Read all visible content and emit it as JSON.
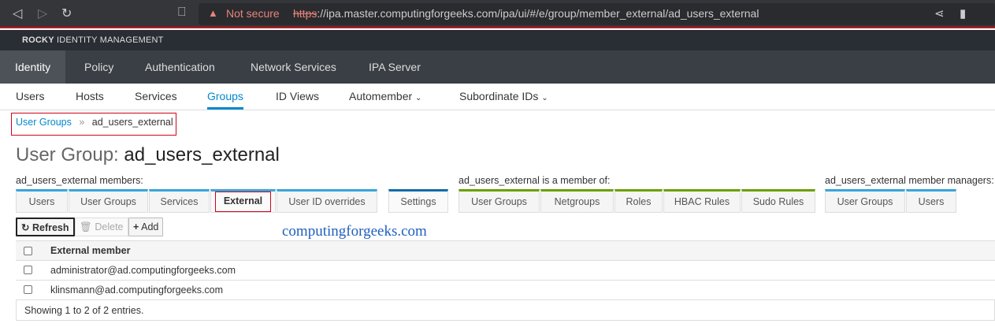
{
  "browser": {
    "security_label": "Not secure",
    "url_scheme": "https",
    "url_rest": "://ipa.master.computingforgeeks.com/ipa/ui/#/e/group/member_external/ad_users_external"
  },
  "brand": {
    "bold": "ROCKY",
    "rest": " IDENTITY MANAGEMENT"
  },
  "primary_nav": [
    "Identity",
    "Policy",
    "Authentication",
    "Network Services",
    "IPA Server"
  ],
  "secondary_nav": [
    "Users",
    "Hosts",
    "Services",
    "Groups",
    "ID Views",
    "Automember",
    "Subordinate IDs"
  ],
  "breadcrumb": {
    "parent": "User Groups",
    "separator": "»",
    "current": "ad_users_external"
  },
  "title": {
    "prefix": "User Group: ",
    "name": "ad_users_external"
  },
  "sections": {
    "members": "ad_users_external members:",
    "member_of": "ad_users_external is a member of:",
    "managers": "ad_users_external member managers:"
  },
  "member_tabs": [
    "Users",
    "User Groups",
    "Services",
    "External",
    "User ID overrides"
  ],
  "settings_tab": "Settings",
  "member_of_tabs": [
    "User Groups",
    "Netgroups",
    "Roles",
    "HBAC Rules",
    "Sudo Rules"
  ],
  "manager_tabs": [
    "User Groups",
    "Users"
  ],
  "actions": {
    "refresh": "Refresh",
    "delete": "Delete",
    "add": "Add"
  },
  "watermark": "computingforgeeks.com",
  "table": {
    "header": "External member",
    "rows": [
      "administrator@ad.computingforgeeks.com",
      "klinsmann@ad.computingforgeeks.com"
    ],
    "footer": "Showing 1 to 2 of 2 entries."
  },
  "colors": {
    "accent": "#0088ce",
    "highlight": "#d0021b",
    "green": "#6ca100"
  }
}
